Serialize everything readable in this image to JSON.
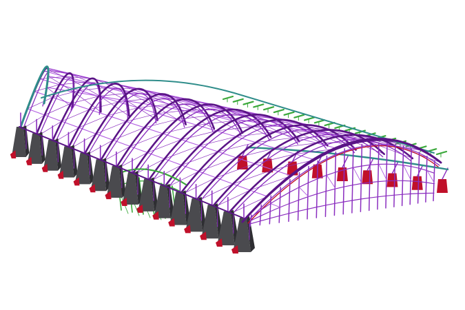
{
  "palette": {
    "background": "#ffffff",
    "steel_purple": "#8a2dbf",
    "steel_purple_dark": "#5a1486",
    "steel_purple_light": "#b05be0",
    "secondary_green": "#3aa83a",
    "teal_roof_edge": "#2f8d8a",
    "concrete_grey": "#4a4a4e",
    "concrete_grey_dark": "#2e2e32",
    "bearing_red": "#c0102a"
  },
  "model": {
    "arch_count": 15,
    "front_columns": 15,
    "back_columns": 9
  }
}
